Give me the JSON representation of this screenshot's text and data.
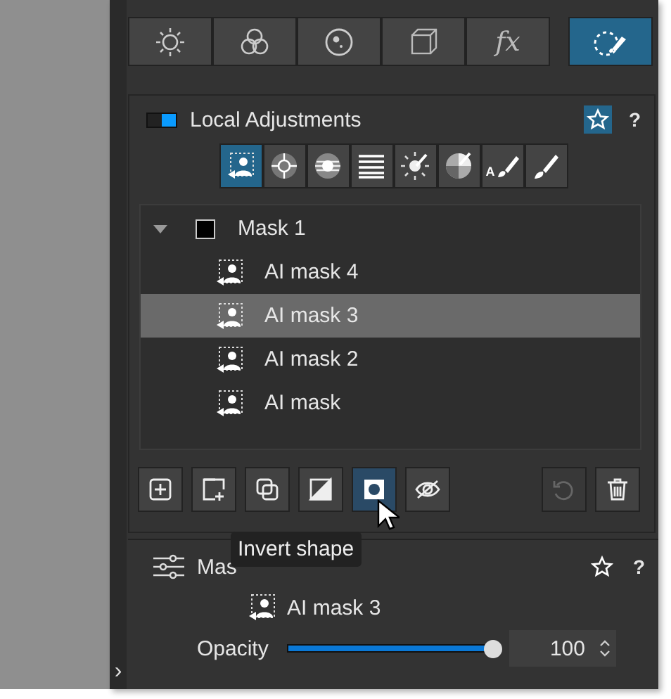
{
  "top_tabs": [
    {
      "kind": "sun",
      "selected": false
    },
    {
      "kind": "rings",
      "selected": false
    },
    {
      "kind": "dot-circle",
      "selected": false
    },
    {
      "kind": "cube",
      "selected": false
    },
    {
      "kind": "text",
      "label": "fx",
      "selected": false
    },
    {
      "kind": "mask-brush",
      "selected": true
    }
  ],
  "local_adjustments": {
    "on": true,
    "title": "Local Adjustments",
    "favorite": true,
    "help": "?",
    "tools": [
      {
        "kind": "person",
        "selected": true
      },
      {
        "kind": "target",
        "selected": false
      },
      {
        "kind": "disc",
        "selected": false
      },
      {
        "kind": "lines",
        "selected": false
      },
      {
        "kind": "sparkle",
        "selected": false
      },
      {
        "kind": "pie",
        "selected": false
      },
      {
        "kind": "text-brush",
        "label": "A",
        "selected": false
      },
      {
        "kind": "brush",
        "selected": false
      }
    ],
    "tree": [
      {
        "label": "Mask 1",
        "expanded": true,
        "children": [
          {
            "label": "AI mask 4",
            "selected": false
          },
          {
            "label": "AI mask 3",
            "selected": true
          },
          {
            "label": "AI mask 2",
            "selected": false
          },
          {
            "label": "AI mask",
            "selected": false
          }
        ]
      }
    ],
    "buttons": [
      {
        "kind": "add",
        "selected": false,
        "disabled": false
      },
      {
        "kind": "add-shape",
        "selected": false,
        "disabled": false
      },
      {
        "kind": "duplicate",
        "selected": false,
        "disabled": false
      },
      {
        "kind": "contrast",
        "selected": false,
        "disabled": false
      },
      {
        "kind": "invert",
        "selected": true,
        "disabled": false
      },
      {
        "kind": "hide",
        "selected": false,
        "disabled": false
      },
      {
        "kind": "undo",
        "selected": false,
        "disabled": true
      },
      {
        "kind": "delete",
        "selected": false,
        "disabled": false
      }
    ],
    "tooltip": "Invert shape"
  },
  "mask_options": {
    "title": "Mas",
    "favorite": false,
    "help": "?",
    "mask_name": "AI mask 3",
    "opacity_label": "Opacity",
    "opacity": {
      "level": 1.0
    },
    "opacity_value": "100"
  },
  "collapse": "›"
}
